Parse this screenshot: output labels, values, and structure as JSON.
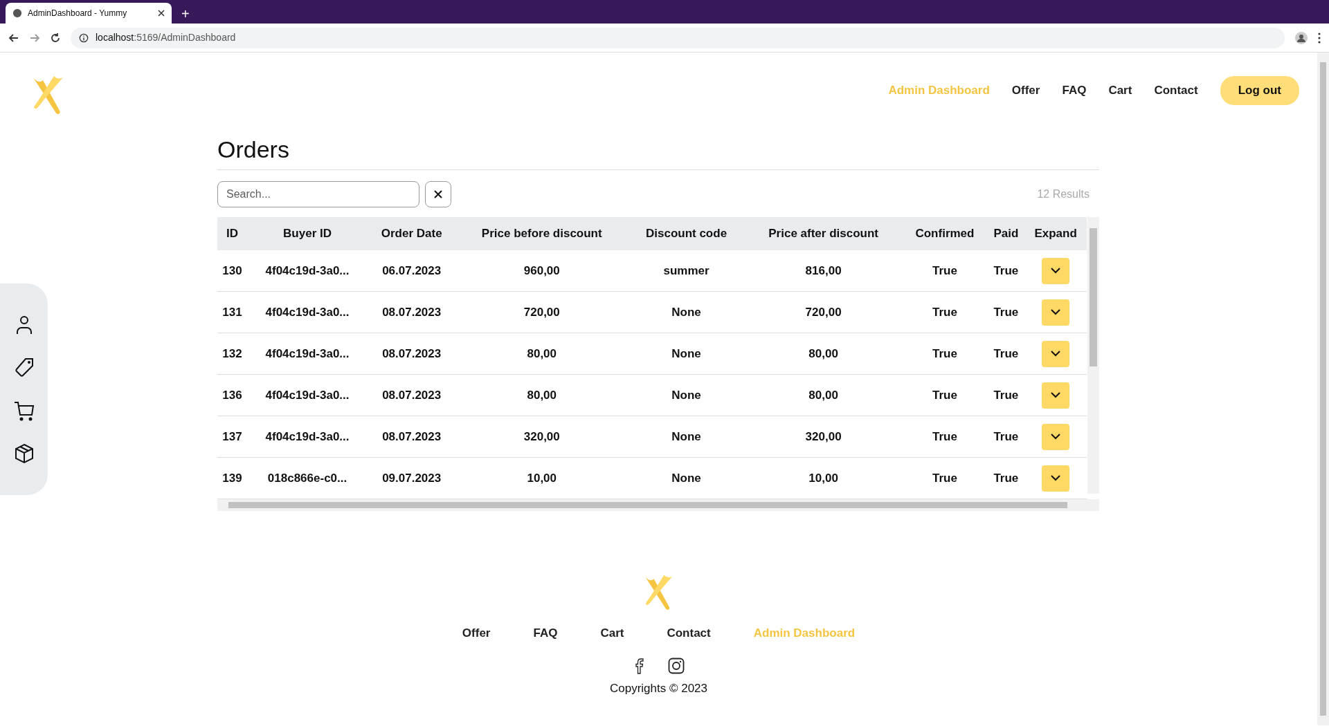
{
  "browser": {
    "tab_title": "AdminDashboard - Yummy",
    "new_tab": "+",
    "url_host": "localhost",
    "url_path": ":5169/AdminDashboard"
  },
  "nav": {
    "links": [
      {
        "label": "Admin Dashboard",
        "selected": true
      },
      {
        "label": "Offer",
        "selected": false
      },
      {
        "label": "FAQ",
        "selected": false
      },
      {
        "label": "Cart",
        "selected": false
      },
      {
        "label": "Contact",
        "selected": false
      }
    ],
    "logout": "Log out"
  },
  "sidebar": {
    "items": [
      {
        "kind": "user"
      },
      {
        "kind": "tag"
      },
      {
        "kind": "cart"
      },
      {
        "kind": "box"
      }
    ]
  },
  "page": {
    "title": "Orders",
    "search": {
      "placeholder": "Search..."
    },
    "results": "12 Results"
  },
  "table": {
    "columns": [
      "ID",
      "Buyer ID",
      "Order Date",
      "Price before discount",
      "Discount code",
      "Price after discount",
      "Confirmed",
      "Paid",
      "Expand"
    ],
    "rows": [
      [
        "130",
        "4f04c19d-3a0...",
        "06.07.2023",
        "960,00",
        "summer",
        "816,00",
        "True",
        "True"
      ],
      [
        "131",
        "4f04c19d-3a0...",
        "08.07.2023",
        "720,00",
        "None",
        "720,00",
        "True",
        "True"
      ],
      [
        "132",
        "4f04c19d-3a0...",
        "08.07.2023",
        "80,00",
        "None",
        "80,00",
        "True",
        "True"
      ],
      [
        "136",
        "4f04c19d-3a0...",
        "08.07.2023",
        "80,00",
        "None",
        "80,00",
        "True",
        "True"
      ],
      [
        "137",
        "4f04c19d-3a0...",
        "08.07.2023",
        "320,00",
        "None",
        "320,00",
        "True",
        "True"
      ],
      [
        "139",
        "018c866e-c0...",
        "09.07.2023",
        "10,00",
        "None",
        "10,00",
        "True",
        "True"
      ]
    ]
  },
  "footer": {
    "links": [
      {
        "label": "Offer",
        "selected": false
      },
      {
        "label": "FAQ",
        "selected": false
      },
      {
        "label": "Cart",
        "selected": false
      },
      {
        "label": "Contact",
        "selected": false
      },
      {
        "label": "Admin Dashboard",
        "selected": true
      }
    ],
    "copyright": "Copyrights © 2023"
  }
}
